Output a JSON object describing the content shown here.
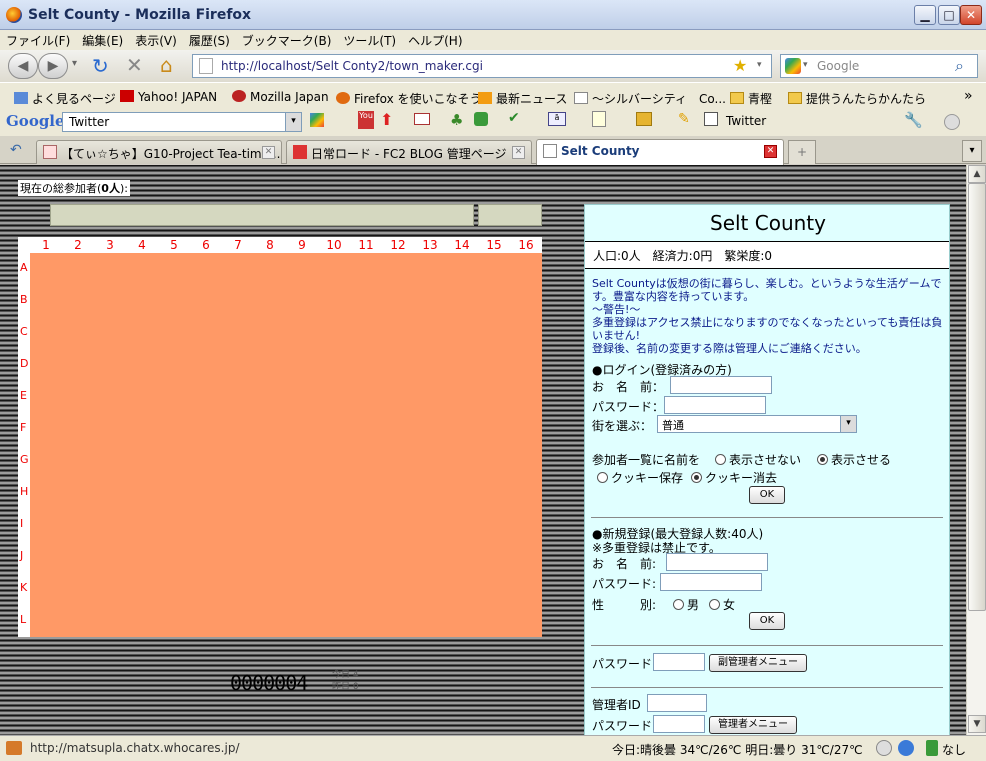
{
  "window": {
    "title": "Selt County - Mozilla Firefox"
  },
  "menu": [
    "ファイル(F)",
    "編集(E)",
    "表示(V)",
    "履歴(S)",
    "ブックマーク(B)",
    "ツール(T)",
    "ヘルプ(H)"
  ],
  "nav": {
    "url": "http://localhost/Selt Conty2/town_maker.cgi",
    "search_placeholder": "Google"
  },
  "bookmarks": [
    "よく見るページ",
    "Yahoo! JAPAN",
    "Mozilla Japan",
    "Firefox を使いこなそう",
    "最新ニュース",
    "〜シルバーシティ　Co...",
    "青樫",
    "提供うんたらかんたら"
  ],
  "google_toolbar": {
    "search_value": "Twitter",
    "twitter_label": "Twitter"
  },
  "tabs": [
    {
      "label": "【てぃ☆ちゃ】G10-Project Tea-time..."
    },
    {
      "label": "日常ロード - FC2 BLOG 管理ページ"
    },
    {
      "label": "Selt County"
    }
  ],
  "page": {
    "participants_prefix": "現在の総参加者(",
    "participants_count": "0人",
    "participants_suffix": "):",
    "col_numbers": [
      "1",
      "2",
      "3",
      "4",
      "5",
      "6",
      "7",
      "8",
      "9",
      "10",
      "11",
      "12",
      "13",
      "14",
      "15",
      "16"
    ],
    "row_letters": [
      "A",
      "B",
      "C",
      "D",
      "E",
      "F",
      "G",
      "H",
      "I",
      "J",
      "K",
      "L"
    ],
    "map_color": "#ff9966",
    "counter": "0000004",
    "counter_today": "今日 4",
    "counter_yesterday": "昨日 0"
  },
  "panel": {
    "title": "Selt County",
    "stats": "人口:0人　経済力:0円　繁栄度:0",
    "intro1": "Selt Countyは仮想の街に暮らし、楽しむ。というような生活ゲームです。豊富な内容を持っています。",
    "intro2": "〜警告!〜",
    "intro3": "多重登録はアクセス禁止になりますのでなくなったといっても責任は負いません!",
    "intro4": "登録後、名前の変更する際は管理人にご連絡ください。",
    "login_heading": "●ログイン(登録済みの方)",
    "name_label": "お　名　前：",
    "password_label": "パスワード：",
    "town_label": "街を選ぶ：",
    "town_value": "普通",
    "show_name_label": "参加者一覧に名前を",
    "hide_option": "表示させない",
    "show_option": "表示させる",
    "cookie_save": "クッキー保存",
    "cookie_delete": "クッキー消去",
    "ok_label": "OK",
    "register_heading": "●新規登録(最大登録人数:40人)",
    "register_note": "※多重登録は禁止です。",
    "reg_name_label": "お　名　前:",
    "reg_password_label": "パスワード:",
    "gender_label": "性　　　別:",
    "male": "男",
    "female": "女",
    "sub_admin_password_label": "パスワード",
    "sub_admin_button": "副管理者メニュー",
    "admin_id_label": "管理者ID",
    "admin_password_label": "パスワード",
    "admin_button": "管理者メニュー"
  },
  "status": {
    "url": "http://matsupla.chatx.whocares.jp/",
    "weather": "今日:晴後曇 34℃/26℃ 明日:曇り 31℃/27℃",
    "right_label": "なし"
  }
}
